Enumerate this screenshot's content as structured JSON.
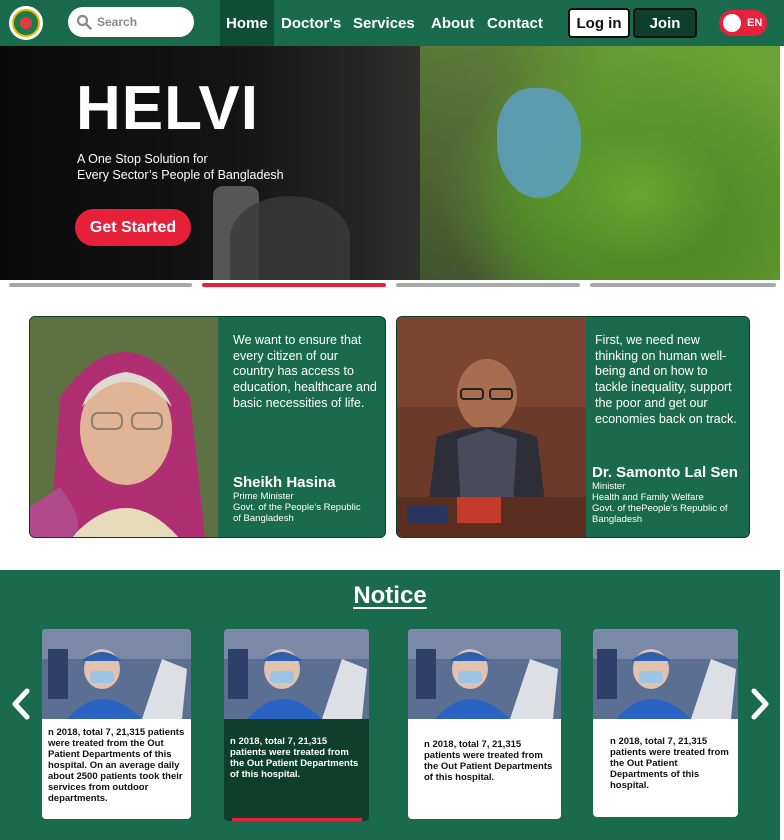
{
  "nav": {
    "search_placeholder": "Search",
    "links": [
      "Home",
      "Doctor's",
      "Services",
      "About",
      "Contact"
    ],
    "login": "Log in",
    "join": "Join",
    "lang": "EN"
  },
  "hero": {
    "title": "HELVI",
    "subtitle_line1": "A One Stop Solution for",
    "subtitle_line2": "Every Sector’s People of Bangladesh",
    "cta": "Get Started",
    "slides_total": 4,
    "slide_active": 2
  },
  "leaders": [
    {
      "quote": "We want to ensure that every citizen of our country has access to education, healthcare and basic necessities of life.",
      "name": "Sheikh Hasina",
      "role1": "Prime Minister",
      "role2": "Govt. of  the People’s Republic",
      "role3": "of Bangladesh"
    },
    {
      "quote": "First, we need new thinking on human well-being and on how to tackle inequality, support the poor and get our economies back on track.",
      "name": "Dr. Samonto Lal Sen",
      "role1": "Minister",
      "role2": "Health and Family Welfare",
      "role3": "Govt. of thePeople’s Republic of Bangladesh"
    }
  ],
  "notice": {
    "title": "Notice",
    "prev_icon": "chevron-left",
    "next_icon": "chevron-right",
    "cards": [
      {
        "text": "n 2018, total 7, 21,315 patients were treated from the Out Patient Departments of this hospital. On an average daily about 2500 patients took their services from outdoor departments."
      },
      {
        "text": "n 2018, total 7, 21,315 patients were treated from the Out Patient Departments of this hospital."
      },
      {
        "text": "n 2018, total 7, 21,315 patients were treated from the Out Patient Departments of this hospital."
      },
      {
        "text": "n 2018, total 7, 21,315 patients were treated from the Out Patient Departments of this hospital."
      }
    ]
  },
  "colors": {
    "brand_green": "#1a6b4e",
    "dark_green": "#0e3f2c",
    "accent_red": "#e8213b"
  }
}
